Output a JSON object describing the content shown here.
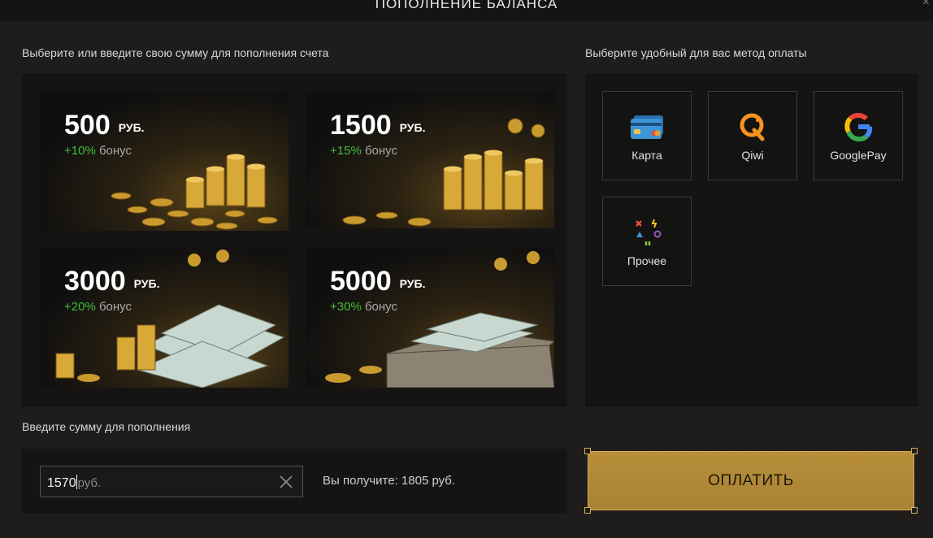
{
  "modal": {
    "title": "ПОПОЛНЕНИЕ БАЛАНСА",
    "close": "×"
  },
  "packages_section": {
    "label": "Выберите или введите свою сумму для пополнения счета",
    "items": [
      {
        "amount": "500",
        "currency": "РУБ.",
        "bonus_pct": "+10%",
        "bonus_word": "бонус"
      },
      {
        "amount": "1500",
        "currency": "РУБ.",
        "bonus_pct": "+15%",
        "bonus_word": "бонус"
      },
      {
        "amount": "3000",
        "currency": "РУБ.",
        "bonus_pct": "+20%",
        "bonus_word": "бонус"
      },
      {
        "amount": "5000",
        "currency": "РУБ.",
        "bonus_pct": "+30%",
        "bonus_word": "бонус"
      }
    ]
  },
  "payment_section": {
    "label": "Выберите удобный для вас метод оплаты",
    "methods": [
      {
        "label": "Карта",
        "icon": "card-icon"
      },
      {
        "label": "Qiwi",
        "icon": "qiwi-icon"
      },
      {
        "label": "GooglePay",
        "icon": "google-icon"
      },
      {
        "label": "Прочее",
        "icon": "other-icon"
      }
    ]
  },
  "amount_section": {
    "label": "Введите сумму для пополнения",
    "value": "1570",
    "unit": "руб.",
    "receive_text": "Вы получите: 1805 руб."
  },
  "pay_button": {
    "label": "ОПЛАТИТЬ"
  },
  "colors": {
    "accent_gold": "#b88e3a",
    "bonus_green": "#3fbf3f",
    "panel_bg": "#151413",
    "page_bg": "#1e1d1b"
  }
}
